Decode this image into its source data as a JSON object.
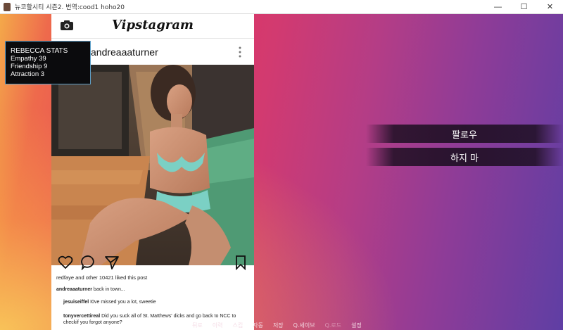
{
  "window": {
    "title": "뉴코할시티 시즌2. 번역:cood1 hoho20",
    "minimize": "—",
    "maximize": "☐",
    "close": "✕"
  },
  "app": {
    "brand": "Vipstagram",
    "username": "andreaaaturner",
    "likes": "redfaye and other 10421 liked this post",
    "caption": {
      "user": "andreaaaturner",
      "text": "back in town..."
    },
    "comments": [
      {
        "user": "jesuiseiffel",
        "text": "I0ve missed you a lot, sweetie"
      },
      {
        "user": "tonyvercettireal",
        "text": "Did you suck all of St. Matthews' dicks and go back to NCC to checkif you forgot anyone?"
      }
    ]
  },
  "stats": {
    "heading": "REBECCA STATS",
    "lines": [
      "Empathy 39",
      "Friendship 9",
      "Attraction 3"
    ]
  },
  "choices": [
    "팔로우",
    "하지 마"
  ],
  "quick_menu": [
    "뒤로",
    "이력",
    "스킵",
    "자동",
    "저장",
    "Q.세이브",
    "Q.로드",
    "설정"
  ],
  "colors": {
    "accent_border": "#5fa0c8",
    "gradient_start": "#f4a94a",
    "gradient_end": "#5f3ea4"
  }
}
